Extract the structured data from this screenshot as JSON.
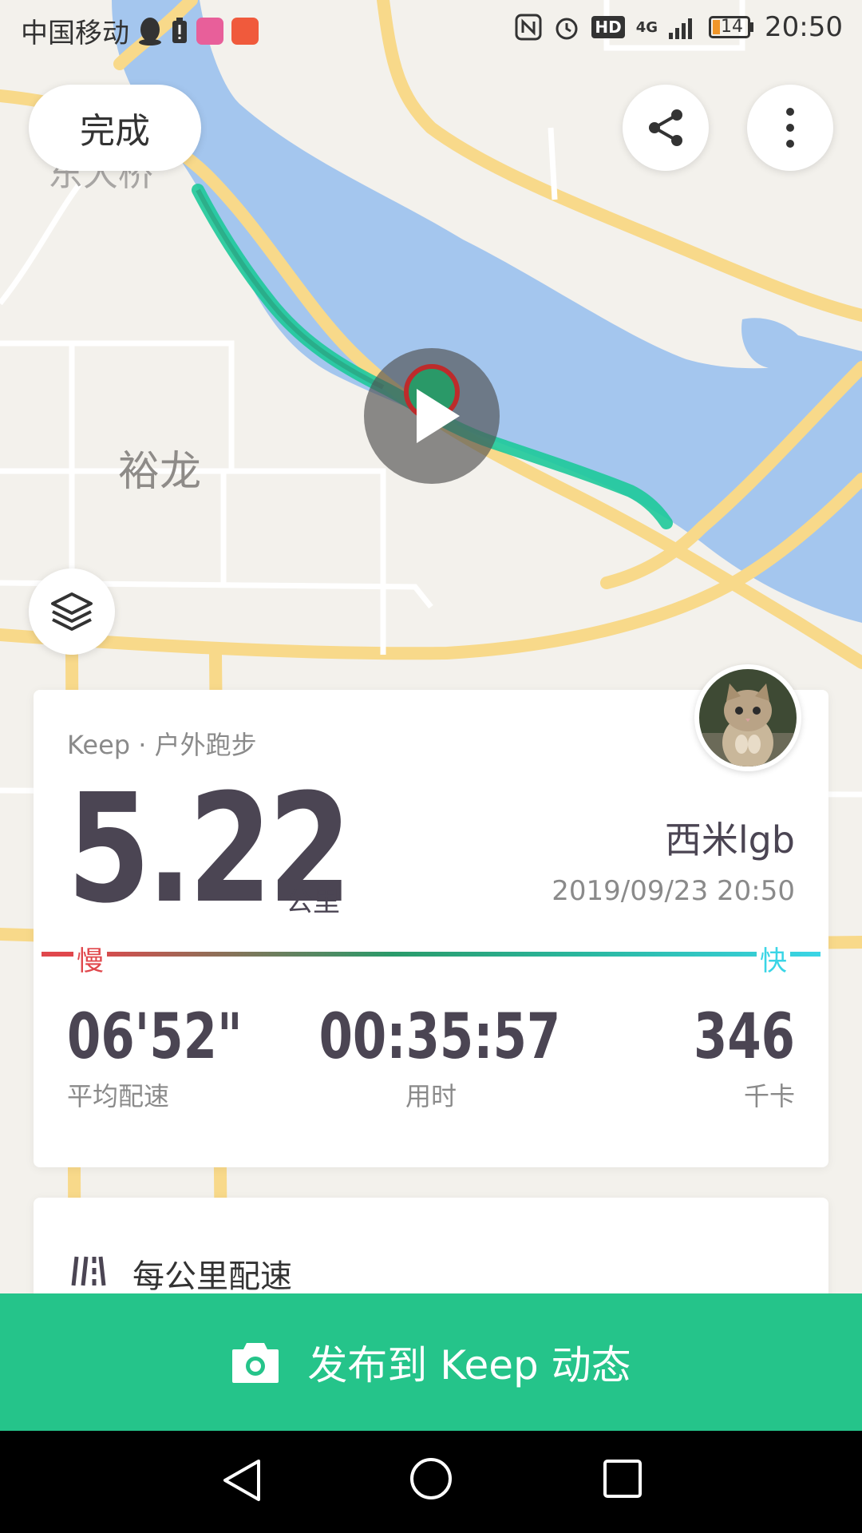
{
  "status_bar": {
    "carrier": "中国移动",
    "time": "20:50",
    "battery": "14",
    "network": "4G",
    "hd": "HD"
  },
  "map": {
    "place_label": "裕龙",
    "place_label_top": "东大桥"
  },
  "top": {
    "done_label": "完成"
  },
  "summary": {
    "source": "Keep · 户外跑步",
    "distance": "5.22",
    "distance_unit": "公里",
    "user_name": "西米lgb",
    "datetime": "2019/09/23 20:50",
    "speed_slow": "慢",
    "speed_fast": "快",
    "stats": [
      {
        "value": "06'52\"",
        "label": "平均配速"
      },
      {
        "value": "00:35:57",
        "label": "用时"
      },
      {
        "value": "346",
        "label": "千卡"
      }
    ]
  },
  "pace_card": {
    "title": "每公里配速"
  },
  "publish": {
    "label": "发布到 Keep 动态"
  },
  "colors": {
    "accent": "#25c48a",
    "slow": "#e0474c",
    "fast": "#3ad5e6",
    "water": "#a4c6ee",
    "road": "#f8d98a"
  }
}
